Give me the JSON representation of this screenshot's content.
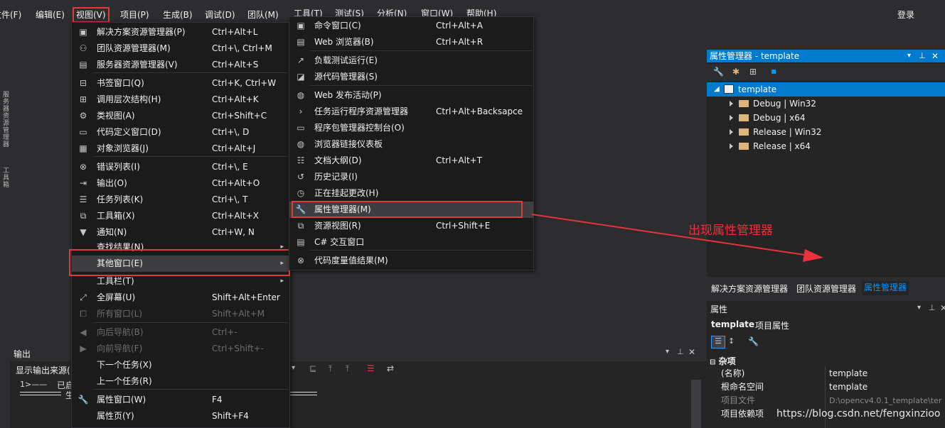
{
  "menubar": {
    "items": [
      "文件(F)",
      "编辑(E)",
      "视图(V)",
      "项目(P)",
      "生成(B)",
      "调试(D)",
      "团队(M)",
      "工具(T)",
      "测试(S)",
      "分析(N)",
      "窗口(W)",
      "帮助(H)"
    ],
    "login": "登录"
  },
  "left_strip": {
    "text1": "服务器资源管理器",
    "text2": "工具箱"
  },
  "output": {
    "title": "输出",
    "source_label": "显示输出来源(",
    "line1_prefix": "1>——",
    "line1_text": "已启",
    "line2_text": "生"
  },
  "view_menu": {
    "items": [
      {
        "icon": "solution-explorer-icon",
        "glyph": "▣",
        "label": "解决方案资源管理器(P)",
        "shortcut": "Ctrl+Alt+L"
      },
      {
        "icon": "team-explorer-icon",
        "glyph": "⚇",
        "label": "团队资源管理器(M)",
        "shortcut": "Ctrl+\\, Ctrl+M"
      },
      {
        "icon": "server-explorer-icon",
        "glyph": "▤",
        "label": "服务器资源管理器(V)",
        "shortcut": "Ctrl+Alt+S"
      },
      {
        "icon": "bookmark-icon",
        "glyph": "⊟",
        "label": "书签窗口(Q)",
        "shortcut": "Ctrl+K, Ctrl+W"
      },
      {
        "icon": "call-hierarchy-icon",
        "glyph": "⊞",
        "label": "调用层次结构(H)",
        "shortcut": "Ctrl+Alt+K"
      },
      {
        "icon": "class-view-icon",
        "glyph": "⚙",
        "label": "类视图(A)",
        "shortcut": "Ctrl+Shift+C"
      },
      {
        "icon": "code-definition-icon",
        "glyph": "▭",
        "label": "代码定义窗口(D)",
        "shortcut": "Ctrl+\\, D"
      },
      {
        "icon": "object-browser-icon",
        "glyph": "▦",
        "label": "对象浏览器(J)",
        "shortcut": "Ctrl+Alt+J"
      },
      {
        "icon": "error-list-icon",
        "glyph": "⊗",
        "label": "错误列表(I)",
        "shortcut": "Ctrl+\\, E"
      },
      {
        "icon": "output-icon",
        "glyph": "⇥",
        "label": "输出(O)",
        "shortcut": "Ctrl+Alt+O"
      },
      {
        "icon": "task-list-icon",
        "glyph": "☰",
        "label": "任务列表(K)",
        "shortcut": "Ctrl+\\, T"
      },
      {
        "icon": "toolbox-icon",
        "glyph": "⧉",
        "label": "工具箱(X)",
        "shortcut": "Ctrl+Alt+X"
      },
      {
        "icon": "notification-icon",
        "glyph": "▼",
        "label": "通知(N)",
        "shortcut": "Ctrl+W, N"
      },
      {
        "icon": "",
        "glyph": "",
        "label": "查找结果(N)",
        "shortcut": ""
      },
      {
        "icon": "",
        "glyph": "",
        "label": "其他窗口(E)",
        "shortcut": ""
      },
      {
        "icon": "",
        "glyph": "",
        "label": "工具栏(T)",
        "shortcut": ""
      },
      {
        "icon": "fullscreen-icon",
        "glyph": "⤢",
        "label": "全屏幕(U)",
        "shortcut": "Shift+Alt+Enter"
      },
      {
        "icon": "all-windows-icon",
        "glyph": "⧠",
        "label": "所有窗口(L)",
        "shortcut": "Shift+Alt+M"
      },
      {
        "icon": "navigate-back-icon",
        "glyph": "◀",
        "label": "向后导航(B)",
        "shortcut": "Ctrl+-"
      },
      {
        "icon": "navigate-forward-icon",
        "glyph": "▶",
        "label": "向前导航(F)",
        "shortcut": "Ctrl+Shift+-"
      },
      {
        "icon": "",
        "glyph": "",
        "label": "下一个任务(X)",
        "shortcut": ""
      },
      {
        "icon": "",
        "glyph": "",
        "label": "上一个任务(R)",
        "shortcut": ""
      },
      {
        "icon": "properties-window-icon",
        "glyph": "🔧",
        "label": "属性窗口(W)",
        "shortcut": "F4"
      },
      {
        "icon": "",
        "glyph": "",
        "label": "属性页(Y)",
        "shortcut": "Shift+F4"
      }
    ]
  },
  "other_windows_menu": {
    "items": [
      {
        "icon": "command-window-icon",
        "glyph": "▣",
        "label": "命令窗口(C)",
        "shortcut": "Ctrl+Alt+A"
      },
      {
        "icon": "web-browser-icon",
        "glyph": "▤",
        "label": "Web 浏览器(B)",
        "shortcut": "Ctrl+Alt+R"
      },
      {
        "icon": "load-test-icon",
        "glyph": "↗",
        "label": "负载测试运行(E)",
        "shortcut": ""
      },
      {
        "icon": "source-control-icon",
        "glyph": "◪",
        "label": "源代码管理器(S)",
        "shortcut": ""
      },
      {
        "icon": "web-publish-icon",
        "glyph": "◍",
        "label": "Web 发布活动(P)",
        "shortcut": ""
      },
      {
        "icon": "task-runner-icon",
        "glyph": "›",
        "label": "任务运行程序资源管理器",
        "shortcut": "Ctrl+Alt+Backsapce"
      },
      {
        "icon": "package-manager-icon",
        "glyph": "▭",
        "label": "程序包管理器控制台(O)",
        "shortcut": ""
      },
      {
        "icon": "browser-link-icon",
        "glyph": "◍",
        "label": "浏览器链接仪表板",
        "shortcut": ""
      },
      {
        "icon": "document-outline-icon",
        "glyph": "☷",
        "label": "文档大纲(D)",
        "shortcut": "Ctrl+Alt+T"
      },
      {
        "icon": "history-icon",
        "glyph": "↺",
        "label": "历史记录(I)",
        "shortcut": ""
      },
      {
        "icon": "pending-changes-icon",
        "glyph": "◷",
        "label": "正在挂起更改(H)",
        "shortcut": ""
      },
      {
        "icon": "property-manager-icon",
        "glyph": "🔧",
        "label": "属性管理器(M)",
        "shortcut": ""
      },
      {
        "icon": "resource-view-icon",
        "glyph": "⧉",
        "label": "资源视图(R)",
        "shortcut": "Ctrl+Shift+E"
      },
      {
        "icon": "csharp-interactive-icon",
        "glyph": "▤",
        "label": "C# 交互窗口",
        "shortcut": ""
      },
      {
        "icon": "code-metrics-icon",
        "glyph": "⊗",
        "label": "代码度量值结果(M)",
        "shortcut": ""
      }
    ]
  },
  "property_manager": {
    "title": "属性管理器 - template",
    "root": "template",
    "configs": [
      "Debug | Win32",
      "Debug | x64",
      "Release | Win32",
      "Release | x64"
    ]
  },
  "bottom_tabs": [
    "解决方案资源管理器",
    "团队资源管理器",
    "属性管理器"
  ],
  "properties": {
    "title": "属性",
    "object_name": "template",
    "object_type": "项目属性",
    "category": "杂项",
    "rows": [
      {
        "key": "(名称)",
        "value": "template"
      },
      {
        "key": "根命名空间",
        "value": "template"
      },
      {
        "key": "项目文件",
        "value": "D:\\opencv4.0.1_template\\ter"
      },
      {
        "key": "项目依赖项",
        "value": ""
      }
    ]
  },
  "annotation": "出现属性管理器",
  "watermark": "https://blog.csdn.net/fengxinzioo",
  "colors": {
    "accent": "#007acc",
    "highlight_red": "#e03b3b",
    "annotation_red": "#e8323c"
  }
}
